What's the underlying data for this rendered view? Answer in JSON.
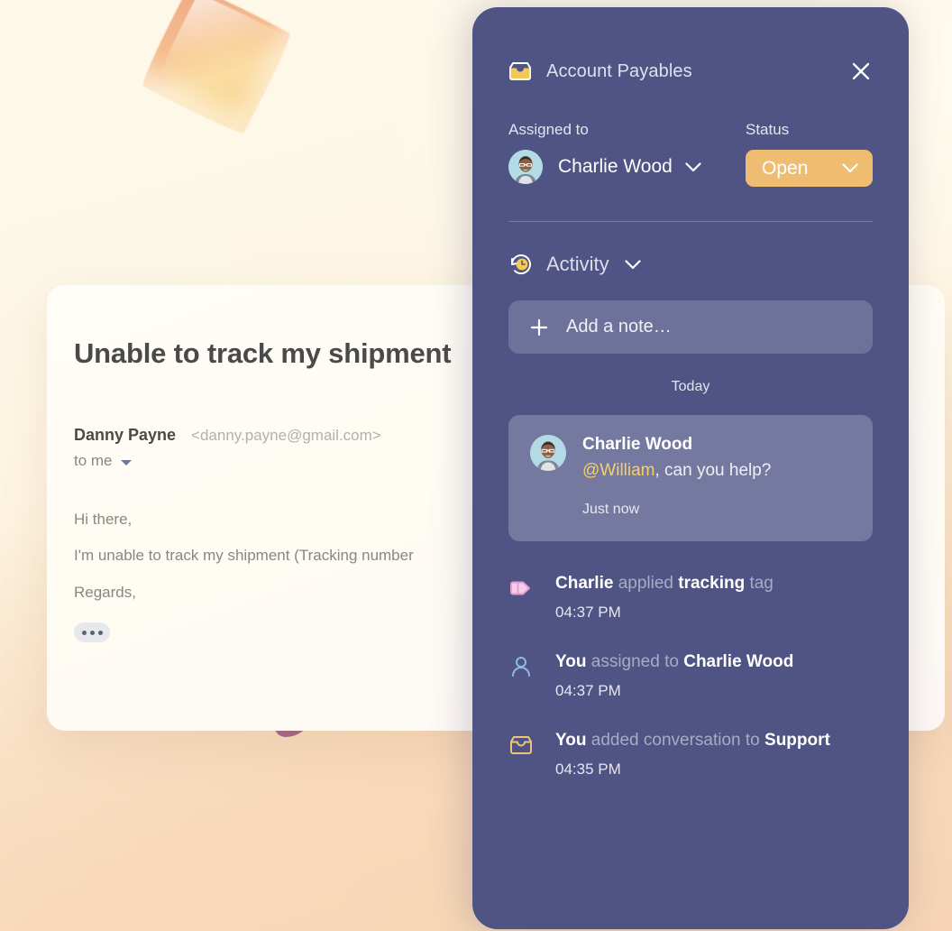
{
  "email": {
    "subject": "Unable to track my shipment",
    "sender_name": "Danny Payne",
    "sender_email": "<danny.payne@gmail.com>",
    "to_line": "to me",
    "greeting": "Hi there,",
    "body_line": "I'm unable to track my shipment (Tracking number",
    "regards": "Regards,",
    "more_icon": "ellipsis-icon",
    "caret_icon": "caret-down-icon"
  },
  "panel": {
    "inbox_icon": "inbox-icon",
    "title": "Account Payables",
    "close_icon": "close-icon",
    "assigned": {
      "label": "Assigned to",
      "avatar": "avatar-charlie-wood",
      "name": "Charlie Wood",
      "chevron_icon": "chevron-down-icon"
    },
    "status": {
      "label": "Status",
      "value": "Open",
      "color": "#efbd71",
      "chevron_icon": "chevron-down-icon"
    },
    "activity": {
      "icon": "clock-history-icon",
      "title": "Activity",
      "chevron_icon": "chevron-down-icon",
      "add_note": {
        "plus_icon": "plus-icon",
        "label": "Add a note…"
      },
      "day_separator": "Today",
      "note": {
        "avatar": "avatar-charlie-wood",
        "author": "Charlie Wood",
        "mention": "@William",
        "text_rest": ", can you help?",
        "time": "Just now"
      },
      "log": [
        {
          "icon": "tag-icon",
          "icon_color": "#e8a8d8",
          "subject": "Charlie",
          "verb": " applied ",
          "object": "tracking",
          "suffix": " tag",
          "time": "04:37 PM"
        },
        {
          "icon": "person-icon",
          "icon_color": "#8fb8e0",
          "subject": "You",
          "verb": " assigned to ",
          "object": "Charlie Wood",
          "suffix": "",
          "time": "04:37 PM"
        },
        {
          "icon": "inbox-icon",
          "icon_color": "#efc478",
          "subject": "You",
          "verb": " added conversation to ",
          "object": "Support",
          "suffix": "",
          "time": "04:35 PM"
        }
      ]
    }
  },
  "decor": {
    "leaf": "leaf-shape",
    "squiggle": "squiggle-shape"
  }
}
